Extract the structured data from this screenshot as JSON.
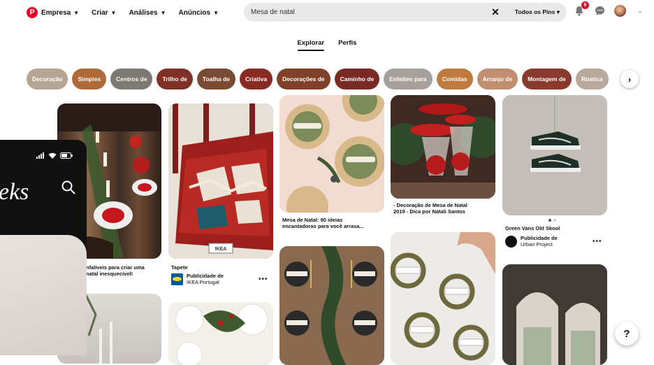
{
  "nav": {
    "business_label": "Empresa",
    "create_label": "Criar",
    "analytics_label": "Análises",
    "ads_label": "Anúncios"
  },
  "search": {
    "query": "Mesa de natal",
    "filter_label": "Todos os Pins"
  },
  "notifications": {
    "count": "6"
  },
  "tabs": [
    {
      "label": "Explorar",
      "active": true
    },
    {
      "label": "Perfis",
      "active": false
    }
  ],
  "pills": [
    {
      "label": "Decoração",
      "color": "#b6a592"
    },
    {
      "label": "Simples",
      "color": "#b06a3a"
    },
    {
      "label": "Centros de",
      "color": "#7c7a73"
    },
    {
      "label": "Trilho de",
      "color": "#7e3124"
    },
    {
      "label": "Toalha de",
      "color": "#7a4b32"
    },
    {
      "label": "Criativa",
      "color": "#8a2b23"
    },
    {
      "label": "Decorações de",
      "color": "#7f4128"
    },
    {
      "label": "Caminho de",
      "color": "#7a2a25"
    },
    {
      "label": "Enfeites para",
      "color": "#a7a19c"
    },
    {
      "label": "Comidas",
      "color": "#c07a3e"
    },
    {
      "label": "Arranjo de",
      "color": "#c08f6f"
    },
    {
      "label": "Montagem de",
      "color": "#8a3a2d"
    },
    {
      "label": "Rústica",
      "color": "#b8a99a"
    }
  ],
  "pins": {
    "col1_caption": "nfalíveis para criar uma\nnatal inesquecível!",
    "col2_caption": "Tapete",
    "col2_advertiser_label": "Publicidade de",
    "col2_advertiser_name": "IKEA Portugal",
    "col2_brand": "IKEA",
    "col3_caption": "Mesa de Natal: 90 ideias\nencantadoras para você arrasa...",
    "col4_caption": "- Decoração de Mesa de Natal\n2019 - Dica por Natali Santos",
    "col5_caption": "Green Vans Old Skool",
    "col5_advertiser_label": "Publicidade de",
    "col5_advertiser_name": "Urban Project",
    "more": "•••"
  },
  "phone": {
    "title": "eks"
  },
  "help_label": "?"
}
